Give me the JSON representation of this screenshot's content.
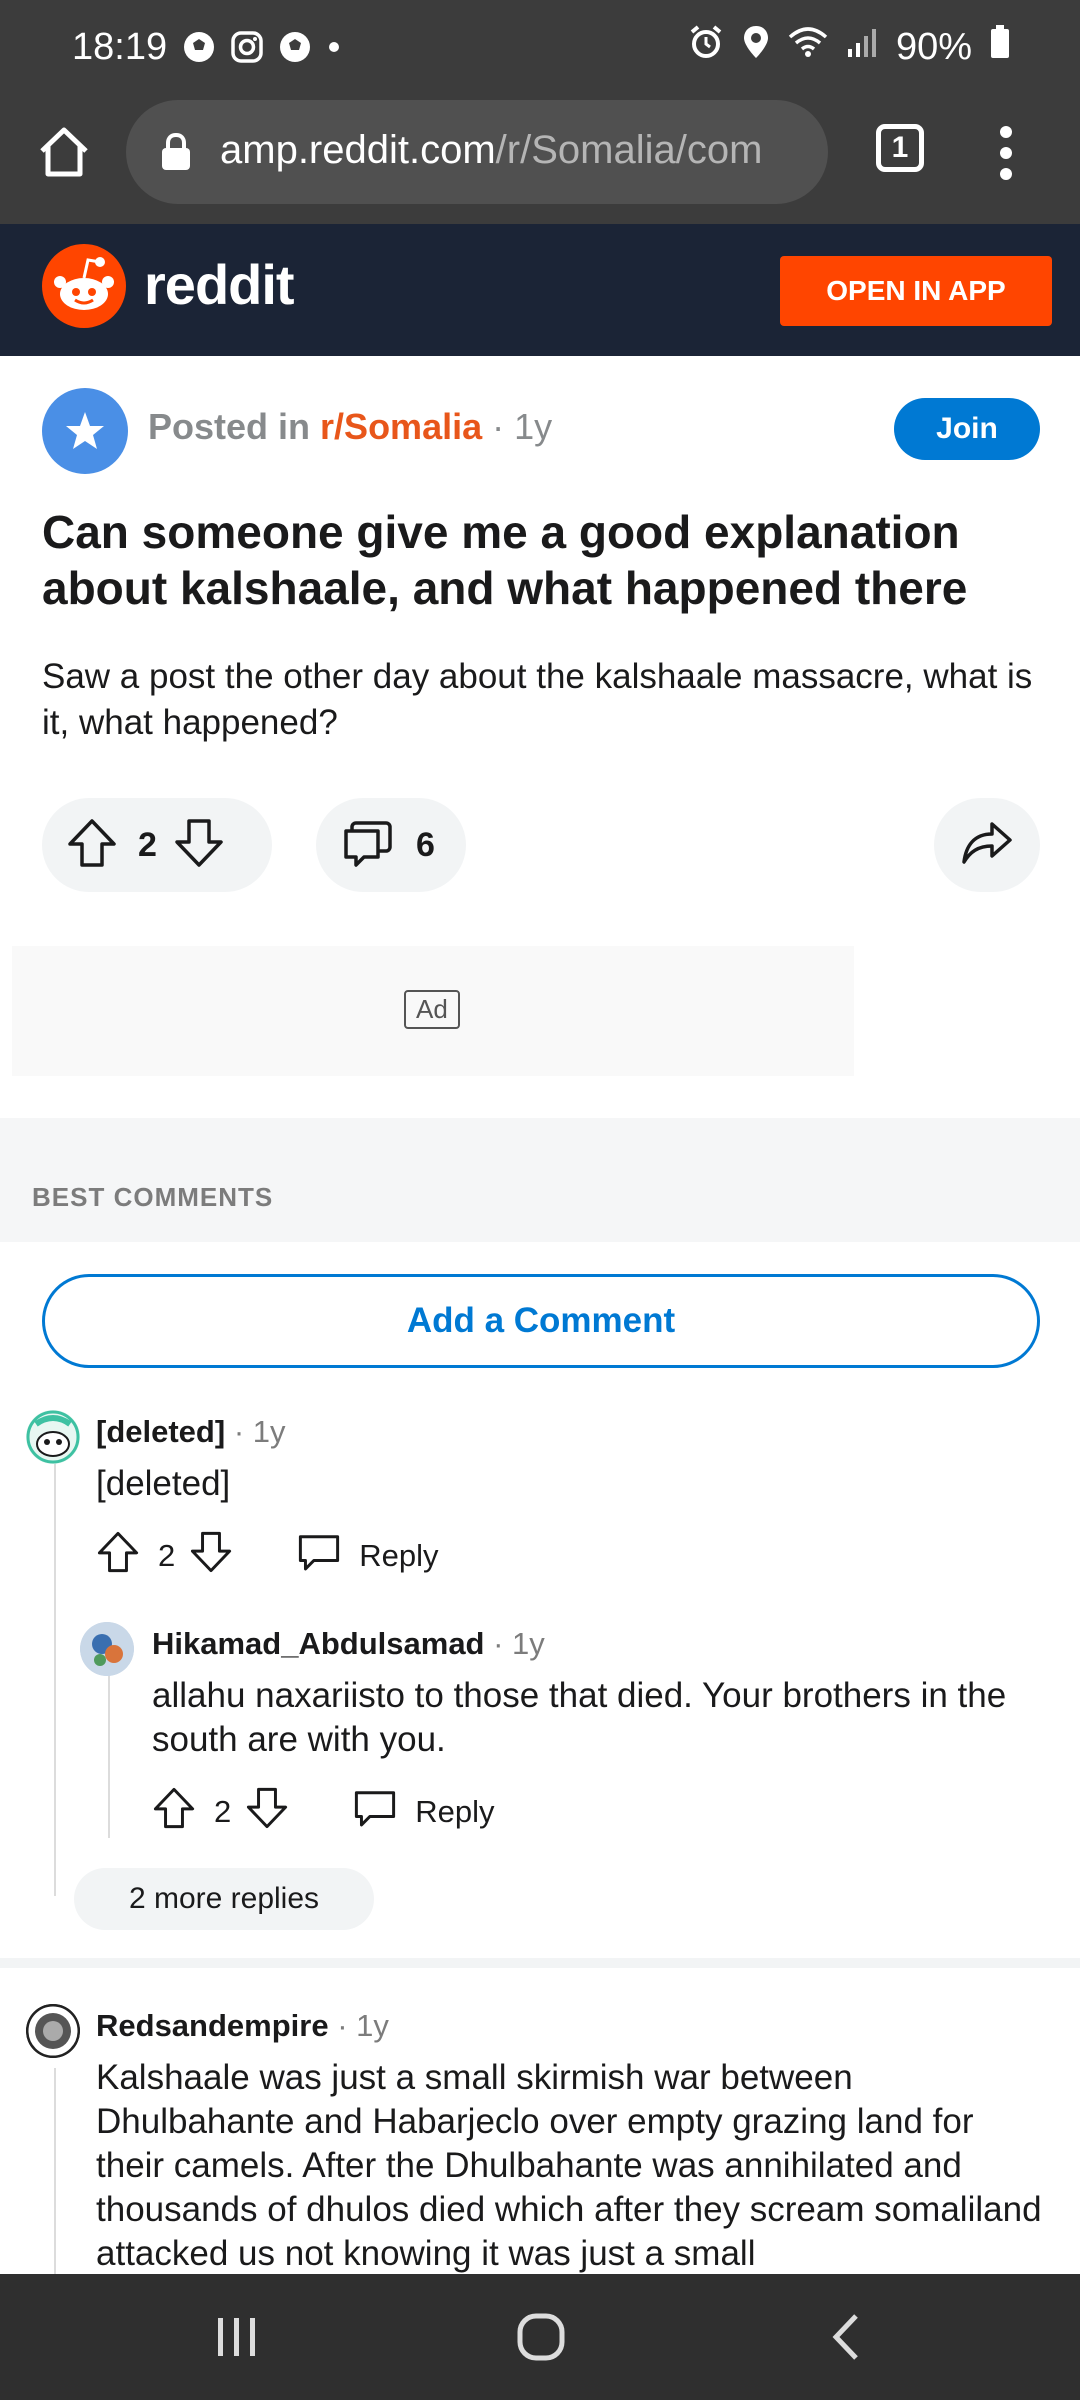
{
  "status": {
    "time": "18:19",
    "battery": "90%"
  },
  "browser": {
    "url_host": "amp.reddit.com",
    "url_path": "/r/Somalia/com",
    "tab_count": "1"
  },
  "header": {
    "wordmark": "reddit",
    "open_in_app": "OPEN IN APP"
  },
  "post": {
    "posted_in": "Posted in",
    "subreddit": "r/Somalia",
    "age": "· 1y",
    "join_label": "Join",
    "title": "Can someone give me a good explanation about kalshaale, and what happened there",
    "body": "Saw a post the other day about the kalshaale massacre, what is it, what happened?",
    "votes": "2",
    "comments": "6"
  },
  "ad_label": "Ad",
  "comments_header": "BEST COMMENTS",
  "add_comment": "Add a Comment",
  "comments": [
    {
      "user": "[deleted]",
      "age": "· 1y",
      "text": "[deleted]",
      "votes": "2",
      "reply": "Reply"
    },
    {
      "user": "Hikamad_Abdulsamad",
      "age": "· 1y",
      "text": "allahu naxariisto to those that died. Your brothers in the south are with you.",
      "votes": "2",
      "reply": "Reply"
    },
    {
      "user": "Redsandempire",
      "age": "· 1y",
      "text": "Kalshaale was just a small skirmish war between Dhulbahante and Habarjeclo over empty grazing land for their camels. After the Dhulbahante was annihilated and thousands of dhulos died which after they scream somaliland attacked us not knowing it was just a small"
    }
  ],
  "more_replies": "2 more replies"
}
